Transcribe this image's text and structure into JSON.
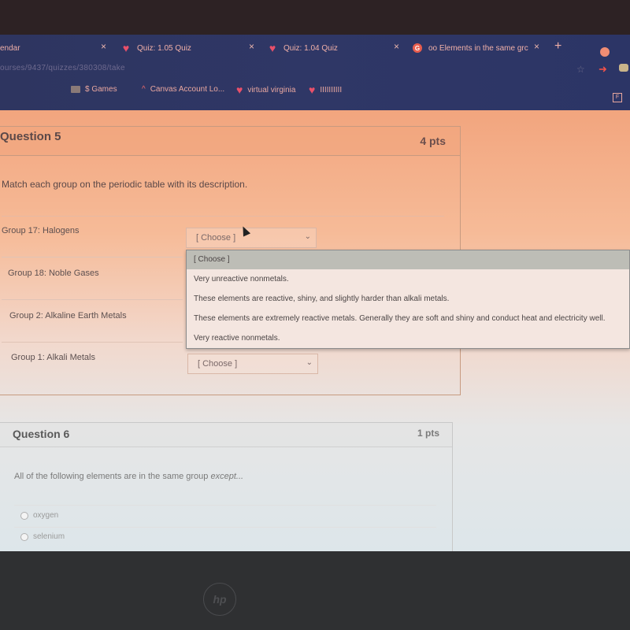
{
  "browser": {
    "tabs": [
      {
        "label": "endar",
        "icon": "calendar-icon"
      },
      {
        "label": "Quiz: 1.05 Quiz",
        "icon": "heart-icon"
      },
      {
        "label": "Quiz: 1.04 Quiz",
        "icon": "heart-icon"
      },
      {
        "label": "oo Elements in the same grc",
        "icon": "google-icon"
      }
    ],
    "close_glyph": "×",
    "new_tab_glyph": "+",
    "url": "ourses/9437/quizzes/380308/take",
    "star_glyph": "☆",
    "bookmarks": [
      {
        "label": "$ Games",
        "icon": "folder-icon"
      },
      {
        "label": "Canvas Account Lo...",
        "icon": "canvas-icon"
      },
      {
        "label": "virtual virginia",
        "icon": "heart-icon"
      },
      {
        "label": "IIIIIIIIII",
        "icon": "heart-icon"
      }
    ]
  },
  "question5": {
    "title": "Question 5",
    "points": "4 pts",
    "prompt": "Match each group on the periodic table with its description.",
    "rows": [
      {
        "label": "Group 17: Halogens",
        "selected": "[ Choose ]"
      },
      {
        "label": "Group 18: Noble Gases",
        "selected": "[ Choose ]"
      },
      {
        "label": "Group 2: Alkaline Earth Metals",
        "selected": "[ Choose ]"
      },
      {
        "label": "Group 1: Alkali Metals",
        "selected": "[ Choose ]"
      }
    ],
    "dropdown_options": [
      "[ Choose ]",
      "Very unreactive nonmetals.",
      "These elements are reactive, shiny, and slightly harder than alkali metals.",
      "These elements are extremely reactive metals. Generally they are soft and shiny and conduct heat and electricity well.",
      "Very reactive nonmetals."
    ],
    "highlighted_option_index": 0
  },
  "question6": {
    "title": "Question 6",
    "points": "1 pts",
    "prompt_main": "All of the following elements are in the same group ",
    "prompt_emphasis": "except...",
    "options": [
      "oxygen",
      "selenium"
    ]
  },
  "device": {
    "logo": "hp"
  }
}
